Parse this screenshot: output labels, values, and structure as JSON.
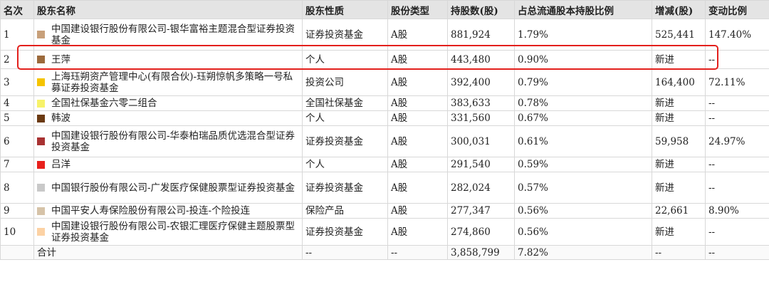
{
  "headers": [
    "名次",
    "股东名称",
    "股东性质",
    "股份类型",
    "持股数(股)",
    "占总流通股本持股比例",
    "增减(股)",
    "变动比例"
  ],
  "rows": [
    {
      "rank": "1",
      "color": "#c8a07a",
      "name": "中国建设银行股份有限公司-银华富裕主题混合型证券投资基金",
      "nature": "证券投资基金",
      "type": "A股",
      "shares": "881,924",
      "ratio": "1.79%",
      "change": "525,441",
      "change_ratio": "147.40%"
    },
    {
      "rank": "2",
      "color": "#9c6a3c",
      "name": "王萍",
      "nature": "个人",
      "type": "A股",
      "shares": "443,480",
      "ratio": "0.90%",
      "change": "新进",
      "change_ratio": "--"
    },
    {
      "rank": "3",
      "color": "#f5c400",
      "name": "上海珏朔资产管理中心(有限合伙)-珏朔惊帆多策略一号私募证券投资基金",
      "nature": "投资公司",
      "type": "A股",
      "shares": "392,400",
      "ratio": "0.79%",
      "change": "164,400",
      "change_ratio": "72.11%"
    },
    {
      "rank": "4",
      "color": "#f7f26a",
      "name": "全国社保基金六零二组合",
      "nature": "全国社保基金",
      "type": "A股",
      "shares": "383,633",
      "ratio": "0.78%",
      "change": "新进",
      "change_ratio": "--"
    },
    {
      "rank": "5",
      "color": "#6b3a12",
      "name": "韩波",
      "nature": "个人",
      "type": "A股",
      "shares": "331,560",
      "ratio": "0.67%",
      "change": "新进",
      "change_ratio": "--"
    },
    {
      "rank": "6",
      "color": "#a83232",
      "name": "中国建设银行股份有限公司-华泰柏瑞品质优选混合型证券投资基金",
      "nature": "证券投资基金",
      "type": "A股",
      "shares": "300,031",
      "ratio": "0.61%",
      "change": "59,958",
      "change_ratio": "24.97%"
    },
    {
      "rank": "7",
      "color": "#e8201c",
      "name": "吕洋",
      "nature": "个人",
      "type": "A股",
      "shares": "291,540",
      "ratio": "0.59%",
      "change": "新进",
      "change_ratio": "--"
    },
    {
      "rank": "8",
      "color": "#c9c9c9",
      "name": "中国银行股份有限公司-广发医疗保健股票型证券投资基金",
      "nature": "证券投资基金",
      "type": "A股",
      "shares": "282,024",
      "ratio": "0.57%",
      "change": "新进",
      "change_ratio": "--"
    },
    {
      "rank": "9",
      "color": "#d6c3a8",
      "name": "中国平安人寿保险股份有限公司-投连-个险投连",
      "nature": "保险产品",
      "type": "A股",
      "shares": "277,347",
      "ratio": "0.56%",
      "change": "22,661",
      "change_ratio": "8.90%"
    },
    {
      "rank": "10",
      "color": "#fcd2a4",
      "name": "中国建设银行股份有限公司-农银汇理医疗保健主题股票型证券投资基金",
      "nature": "证券投资基金",
      "type": "A股",
      "shares": "274,860",
      "ratio": "0.56%",
      "change": "新进",
      "change_ratio": "--"
    }
  ],
  "total": {
    "label": "合计",
    "nature": "--",
    "type": "--",
    "shares": "3,858,799",
    "ratio": "7.82%",
    "change": "--",
    "change_ratio": "--"
  },
  "highlight_color": "#e3201c"
}
